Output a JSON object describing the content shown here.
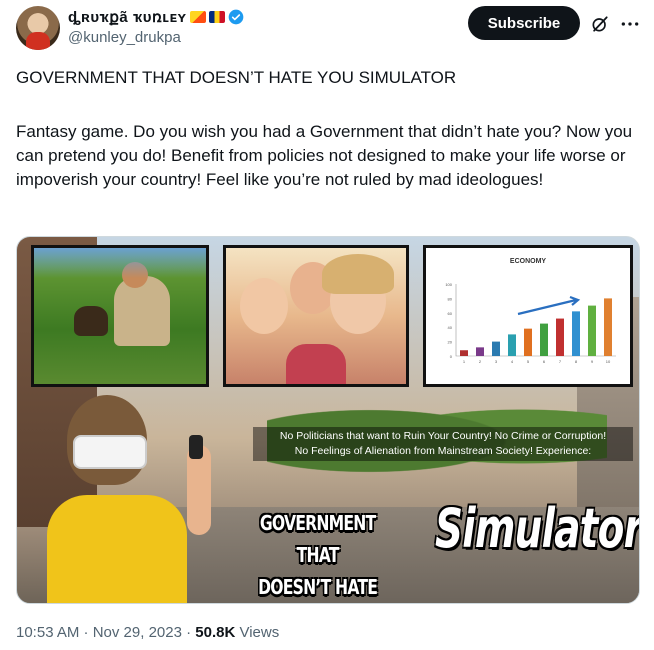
{
  "author": {
    "display_name": "ȡʀᴜҡքã ҡᴜռʟᴇʏ",
    "handle": "@kunley_drukpa",
    "badges": [
      "flag-bhutan-icon",
      "flag-romania-icon",
      "verified-badge-icon"
    ]
  },
  "actions": {
    "subscribe_label": "Subscribe",
    "grok_icon": "grok-icon",
    "more_icon": "more-options-icon"
  },
  "tweet": {
    "title": "GOVERNMENT THAT DOESN’T HATE YOU SIMULATOR",
    "body": "Fantasy game. Do you wish you had a Government that didn’t hate you? Now you can pretend you do! Benefit from policies not designed to make your life worse or impoverish your country! Feel like you’re not ruled by mad ideologues!"
  },
  "media": {
    "panel_chart_title": "ECONOMY",
    "overlay_line_1": "No Politicians that want to Ruin Your Country! No Crime or Corruption!",
    "overlay_line_2": "No Feelings of Alienation from Mainstream Society! Experience:",
    "headline_line_1": "GOVERNMENT THAT",
    "headline_line_2": "DOESN’T HATE YOU",
    "headline_big": "Simulator"
  },
  "chart_data": {
    "type": "bar",
    "title": "ECONOMY",
    "categories": [
      "1",
      "2",
      "3",
      "4",
      "5",
      "6",
      "7",
      "8",
      "9",
      "10"
    ],
    "values": [
      8,
      12,
      20,
      30,
      38,
      45,
      52,
      62,
      70,
      80
    ],
    "ylim": [
      0,
      100
    ],
    "yticks": [
      "0",
      "20",
      "40",
      "60",
      "80",
      "100"
    ],
    "colors": [
      "#b03030",
      "#7a3a8a",
      "#2a7ab0",
      "#2aa0b0",
      "#e07020",
      "#40a040",
      "#c03030",
      "#3090d0",
      "#60b040",
      "#e08030"
    ]
  },
  "footer": {
    "time": "10:53 AM · Nov 29, 2023 · ",
    "views_count": "50.8K",
    "views_label": " Views"
  }
}
